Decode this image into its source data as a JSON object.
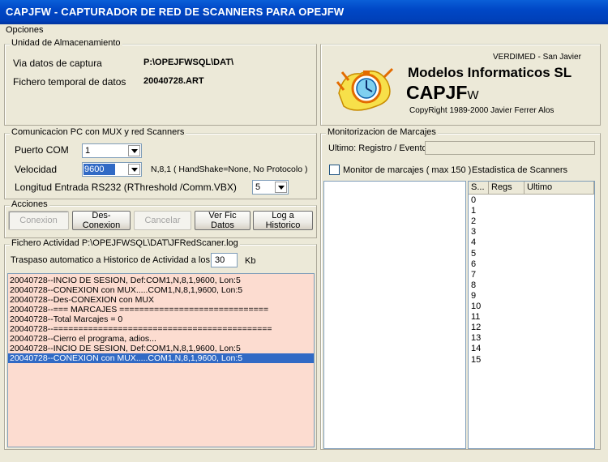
{
  "window": {
    "title": "CAPJFW - CAPTURADOR DE RED DE SCANNERS PARA OPEJFW"
  },
  "menu": {
    "opciones": "Opciones"
  },
  "storage": {
    "title": "Unidad de Almacenamiento",
    "path_label": "Via datos de captura",
    "path_value": "P:\\OPEJFWSQL\\DAT\\",
    "temp_label": "Fichero temporal de datos",
    "temp_value": "20040728.ART"
  },
  "brand": {
    "location": "VERDIMED - San Javier",
    "company": "Modelos Informaticos SL",
    "product_main": "CAPJF",
    "product_suffix": "W",
    "copyright": "CopyRight 1989-2000 Javier Ferrer Alos"
  },
  "comm": {
    "title": "Comunicacion PC con MUX y red Scanners",
    "port_label": "Puerto COM",
    "port_value": "1",
    "speed_label": "Velocidad",
    "speed_value": "9600",
    "speed_info": "N,8,1 ( HandShake=None, No Protocolo )",
    "rs232_label": "Longitud Entrada RS232 (RThreshold /Comm.VBX)",
    "rs232_value": "5"
  },
  "actions": {
    "title": "Acciones",
    "conexion": "Conexion",
    "desconexion": "Des-Conexion",
    "cancelar": "Cancelar",
    "ver_fic": "Ver Fic Datos",
    "log_historico": "Log a Historico"
  },
  "activity": {
    "title": "Fichero Actividad P:\\OPEJFWSQL\\DAT\\JFRedScaner.log",
    "transfer_label": "Traspaso automatico a Historico de Actividad a los",
    "transfer_value": "30",
    "transfer_unit": "Kb",
    "lines": [
      "20040728--INCIO DE SESION, Def:COM1,N,8,1,9600, Lon:5",
      "20040728--CONEXION con MUX.....COM1,N,8,1,9600, Lon:5",
      "20040728--Des-CONEXION con MUX",
      "20040728--=== MARCAJES ==============================",
      "20040728--Total Marcajes = 0",
      "20040728--============================================",
      "20040728--Cierro el programa, adios...",
      "20040728--INCIO DE SESION, Def:COM1,N,8,1,9600, Lon:5",
      "20040728--CONEXION con MUX.....COM1,N,8,1,9600, Lon:5"
    ],
    "selected_index": 8
  },
  "monitor": {
    "title": "Monitorizacion de Marcajes",
    "last_label": "Ultimo: Registro / Evento",
    "last_value": "",
    "checkbox_label": "Monitor de marcajes  ( max 150 )",
    "stats_label": "Estadistica de Scanners",
    "grid_headers": [
      "S...",
      "Regs",
      "Ultimo"
    ],
    "scanners": [
      "0",
      "1",
      "2",
      "3",
      "4",
      "5",
      "6",
      "7",
      "8",
      "9",
      "10",
      "11",
      "12",
      "13",
      "14",
      "15"
    ]
  }
}
